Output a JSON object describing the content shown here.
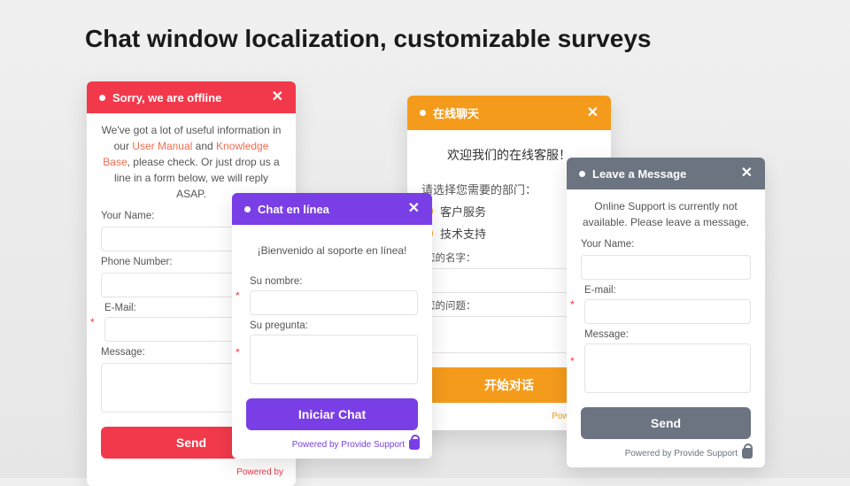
{
  "page": {
    "title": "Chat window localization, customizable surveys"
  },
  "footer": {
    "powered": "Powered by Provide Support",
    "powered_short": "Powered by"
  },
  "c1": {
    "title": "Sorry, we are offline",
    "intro_a": "We've got a lot of useful information in our ",
    "link1": "User Manual",
    "intro_b": " and ",
    "link2": "Knowledge Base",
    "intro_c": ", please check. Or just drop us a line in a form below, we will reply ASAP.",
    "f1": "Your Name:",
    "f2": "Phone Number:",
    "f3": "E-Mail:",
    "f4": "Message:",
    "btn": "Send"
  },
  "c2": {
    "title": "Chat en línea",
    "intro": "¡Bienvenido al soporte en línea!",
    "f1": "Su nombre:",
    "f2": "Su pregunta:",
    "btn": "Iniciar Chat"
  },
  "c3": {
    "title": "在线聊天",
    "intro": "欢迎我们的在线客服！",
    "dept": "请选择您需要的部门：",
    "opt1": "客户服务",
    "opt2": "技术支持",
    "f1": "您的名字：",
    "f2": "您的问题：",
    "btn": "开始对话"
  },
  "c4": {
    "title": "Leave a Message",
    "intro": "Online Support is currently not available. Please leave a message.",
    "f1": "Your Name:",
    "f2": "E-mail:",
    "f3": "Message:",
    "btn": "Send"
  }
}
